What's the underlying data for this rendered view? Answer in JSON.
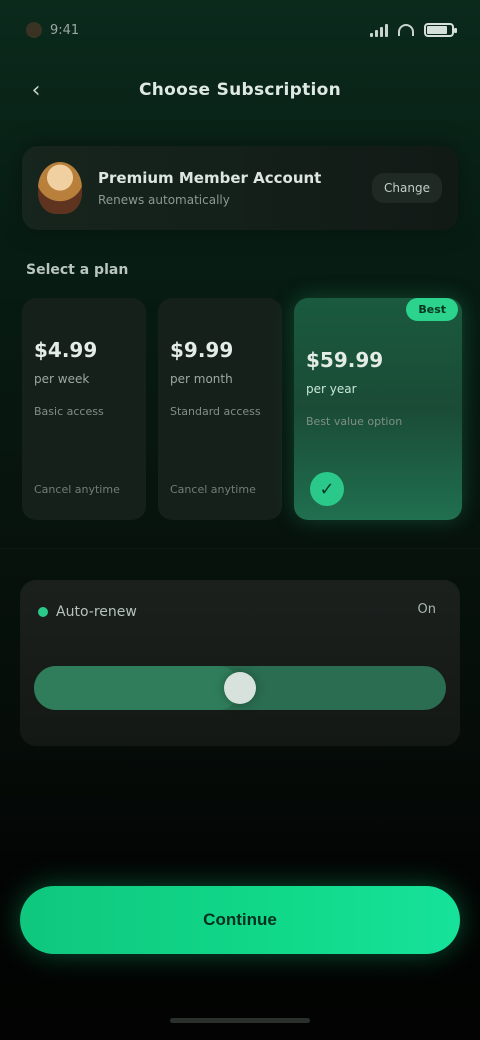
{
  "status_bar": {
    "time": "9:41",
    "signal_bars": 4,
    "battery_level": 0.85
  },
  "header": {
    "back_icon": "chevron-left-icon",
    "title": "Choose Subscription"
  },
  "profile": {
    "name": "Premium Member Account",
    "subtitle": "Renews automatically",
    "action_label": "Change"
  },
  "plans_section": {
    "title": "Select a plan",
    "plans": [
      {
        "price": "$4.99",
        "period": "per week",
        "description": "Basic access",
        "note": "Cancel anytime"
      },
      {
        "price": "$9.99",
        "period": "per month",
        "description": "Standard access",
        "note": "Cancel anytime"
      },
      {
        "badge": "Best",
        "price": "$59.99",
        "period": "per year",
        "description": "Best value option",
        "selected": true
      }
    ]
  },
  "auto_renew": {
    "label": "Auto-renew",
    "value_text": "On",
    "slider_value": 0.5
  },
  "cta": {
    "label": "Continue"
  },
  "colors": {
    "accent": "#11d98a",
    "card": "#16201b",
    "selected_card": "#1a5a3e"
  }
}
